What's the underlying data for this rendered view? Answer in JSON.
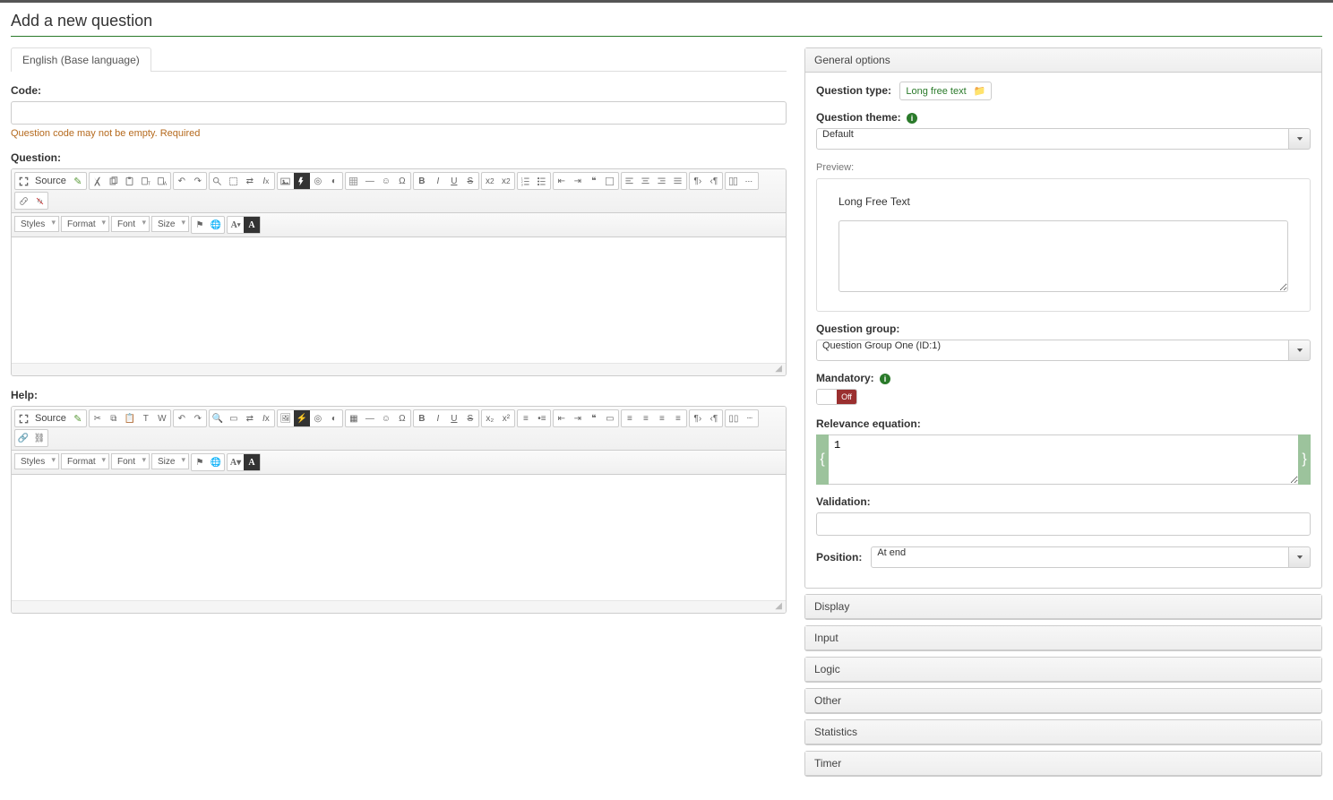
{
  "page": {
    "title": "Add a new question"
  },
  "tabs": [
    {
      "label": "English (Base language)"
    }
  ],
  "form": {
    "code_label": "Code:",
    "code_value": "",
    "code_error": "Question code may not be empty. Required",
    "question_label": "Question:",
    "help_label": "Help:"
  },
  "editor": {
    "source_label": "Source",
    "styles_label": "Styles",
    "format_label": "Format",
    "font_label": "Font",
    "size_label": "Size"
  },
  "side": {
    "general_options": "General options",
    "question_type_label": "Question type:",
    "question_type_value": "Long free text",
    "question_theme_label": "Question theme:",
    "question_theme_value": "Default",
    "preview_label": "Preview:",
    "preview_title": "Long Free Text",
    "question_group_label": "Question group:",
    "question_group_value": "Question Group One (ID:1)",
    "mandatory_label": "Mandatory:",
    "mandatory_off": "Off",
    "relevance_label": "Relevance equation:",
    "relevance_value": "1",
    "validation_label": "Validation:",
    "validation_value": "",
    "position_label": "Position:",
    "position_value": "At end"
  },
  "accordion": [
    "Display",
    "Input",
    "Logic",
    "Other",
    "Statistics",
    "Timer"
  ],
  "colors": {
    "accent": "#2a7a2a",
    "danger": "#9a2f2f"
  }
}
